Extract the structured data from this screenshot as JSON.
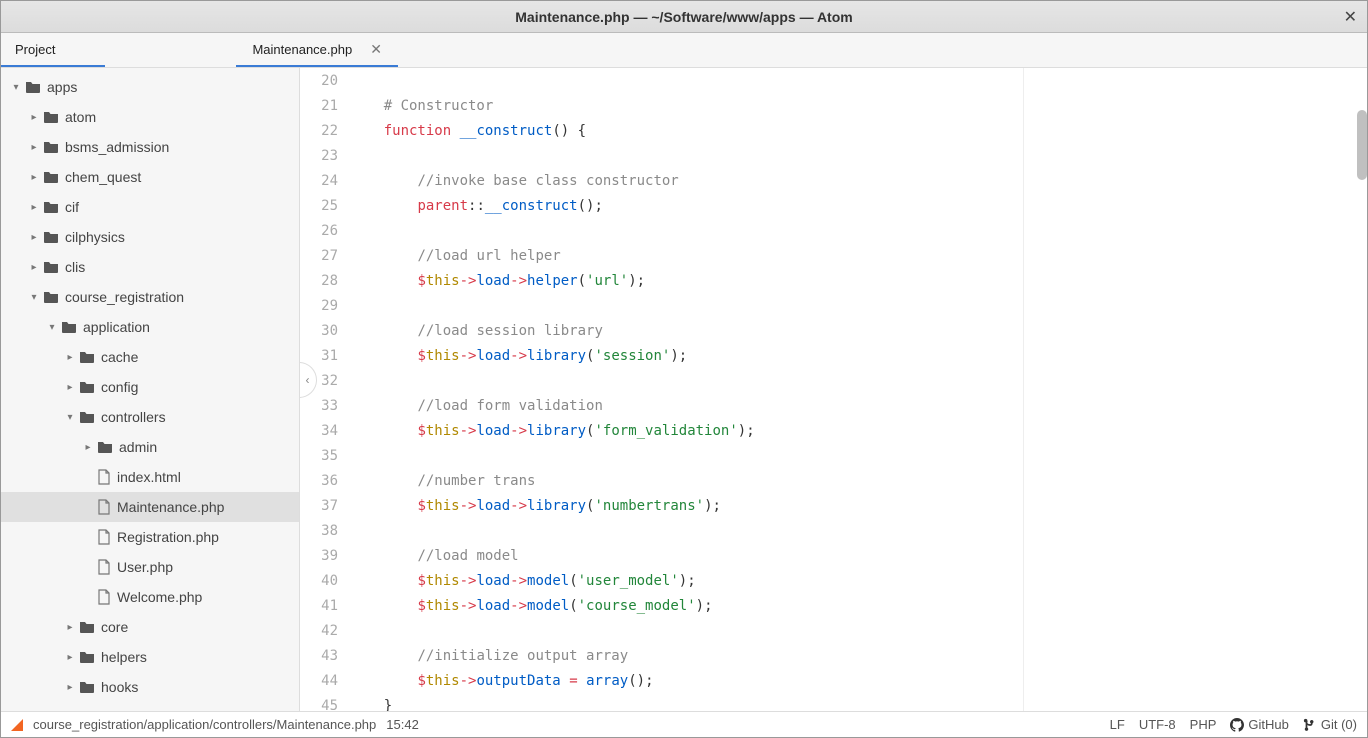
{
  "window": {
    "title": "Maintenance.php — ~/Software/www/apps — Atom"
  },
  "dock": {
    "project_label": "Project"
  },
  "tabs": [
    {
      "label": "Maintenance.php",
      "active": true
    }
  ],
  "tree": [
    {
      "depth": 0,
      "type": "folder",
      "open": true,
      "name": "apps"
    },
    {
      "depth": 1,
      "type": "folder",
      "open": false,
      "name": "atom"
    },
    {
      "depth": 1,
      "type": "folder",
      "open": false,
      "name": "bsms_admission"
    },
    {
      "depth": 1,
      "type": "folder",
      "open": false,
      "name": "chem_quest"
    },
    {
      "depth": 1,
      "type": "folder",
      "open": false,
      "name": "cif"
    },
    {
      "depth": 1,
      "type": "folder",
      "open": false,
      "name": "cilphysics"
    },
    {
      "depth": 1,
      "type": "folder",
      "open": false,
      "name": "clis"
    },
    {
      "depth": 1,
      "type": "folder",
      "open": true,
      "name": "course_registration"
    },
    {
      "depth": 2,
      "type": "folder",
      "open": true,
      "name": "application"
    },
    {
      "depth": 3,
      "type": "folder",
      "open": false,
      "name": "cache"
    },
    {
      "depth": 3,
      "type": "folder",
      "open": false,
      "name": "config"
    },
    {
      "depth": 3,
      "type": "folder",
      "open": true,
      "name": "controllers"
    },
    {
      "depth": 4,
      "type": "folder",
      "open": false,
      "name": "admin"
    },
    {
      "depth": 4,
      "type": "file",
      "name": "index.html"
    },
    {
      "depth": 4,
      "type": "file",
      "name": "Maintenance.php",
      "selected": true
    },
    {
      "depth": 4,
      "type": "file",
      "name": "Registration.php"
    },
    {
      "depth": 4,
      "type": "file",
      "name": "User.php"
    },
    {
      "depth": 4,
      "type": "file",
      "name": "Welcome.php"
    },
    {
      "depth": 3,
      "type": "folder",
      "open": false,
      "name": "core"
    },
    {
      "depth": 3,
      "type": "folder",
      "open": false,
      "name": "helpers"
    },
    {
      "depth": 3,
      "type": "folder",
      "open": false,
      "name": "hooks"
    }
  ],
  "editor": {
    "first_line": 20,
    "lines": [
      [],
      [
        {
          "t": "    ",
          "c": null
        },
        {
          "t": "# Constructor",
          "c": "cmt"
        }
      ],
      [
        {
          "t": "    ",
          "c": null
        },
        {
          "t": "function",
          "c": "kw"
        },
        {
          "t": " ",
          "c": null
        },
        {
          "t": "__construct",
          "c": "fn"
        },
        {
          "t": "() {",
          "c": null
        }
      ],
      [],
      [
        {
          "t": "        ",
          "c": null
        },
        {
          "t": "//invoke base class constructor",
          "c": "cmt"
        }
      ],
      [
        {
          "t": "        ",
          "c": null
        },
        {
          "t": "parent",
          "c": "kw"
        },
        {
          "t": "::",
          "c": null
        },
        {
          "t": "__construct",
          "c": "fn"
        },
        {
          "t": "();",
          "c": null
        }
      ],
      [],
      [
        {
          "t": "        ",
          "c": null
        },
        {
          "t": "//load url helper",
          "c": "cmt"
        }
      ],
      [
        {
          "t": "        ",
          "c": null
        },
        {
          "t": "$",
          "c": "op"
        },
        {
          "t": "this",
          "c": "var"
        },
        {
          "t": "->",
          "c": "op"
        },
        {
          "t": "load",
          "c": "prop"
        },
        {
          "t": "->",
          "c": "op"
        },
        {
          "t": "helper",
          "c": "fn"
        },
        {
          "t": "(",
          "c": null
        },
        {
          "t": "'url'",
          "c": "str"
        },
        {
          "t": ");",
          "c": null
        }
      ],
      [],
      [
        {
          "t": "        ",
          "c": null
        },
        {
          "t": "//load session library",
          "c": "cmt"
        }
      ],
      [
        {
          "t": "        ",
          "c": null
        },
        {
          "t": "$",
          "c": "op"
        },
        {
          "t": "this",
          "c": "var"
        },
        {
          "t": "->",
          "c": "op"
        },
        {
          "t": "load",
          "c": "prop"
        },
        {
          "t": "->",
          "c": "op"
        },
        {
          "t": "library",
          "c": "fn"
        },
        {
          "t": "(",
          "c": null
        },
        {
          "t": "'session'",
          "c": "str"
        },
        {
          "t": ");",
          "c": null
        }
      ],
      [],
      [
        {
          "t": "        ",
          "c": null
        },
        {
          "t": "//load form validation",
          "c": "cmt"
        }
      ],
      [
        {
          "t": "        ",
          "c": null
        },
        {
          "t": "$",
          "c": "op"
        },
        {
          "t": "this",
          "c": "var"
        },
        {
          "t": "->",
          "c": "op"
        },
        {
          "t": "load",
          "c": "prop"
        },
        {
          "t": "->",
          "c": "op"
        },
        {
          "t": "library",
          "c": "fn"
        },
        {
          "t": "(",
          "c": null
        },
        {
          "t": "'form_validation'",
          "c": "str"
        },
        {
          "t": ");",
          "c": null
        }
      ],
      [],
      [
        {
          "t": "        ",
          "c": null
        },
        {
          "t": "//number trans",
          "c": "cmt"
        }
      ],
      [
        {
          "t": "        ",
          "c": null
        },
        {
          "t": "$",
          "c": "op"
        },
        {
          "t": "this",
          "c": "var"
        },
        {
          "t": "->",
          "c": "op"
        },
        {
          "t": "load",
          "c": "prop"
        },
        {
          "t": "->",
          "c": "op"
        },
        {
          "t": "library",
          "c": "fn"
        },
        {
          "t": "(",
          "c": null
        },
        {
          "t": "'numbertrans'",
          "c": "str"
        },
        {
          "t": ");",
          "c": null
        }
      ],
      [],
      [
        {
          "t": "        ",
          "c": null
        },
        {
          "t": "//load model",
          "c": "cmt"
        }
      ],
      [
        {
          "t": "        ",
          "c": null
        },
        {
          "t": "$",
          "c": "op"
        },
        {
          "t": "this",
          "c": "var"
        },
        {
          "t": "->",
          "c": "op"
        },
        {
          "t": "load",
          "c": "prop"
        },
        {
          "t": "->",
          "c": "op"
        },
        {
          "t": "model",
          "c": "fn"
        },
        {
          "t": "(",
          "c": null
        },
        {
          "t": "'user_model'",
          "c": "str"
        },
        {
          "t": ");",
          "c": null
        }
      ],
      [
        {
          "t": "        ",
          "c": null
        },
        {
          "t": "$",
          "c": "op"
        },
        {
          "t": "this",
          "c": "var"
        },
        {
          "t": "->",
          "c": "op"
        },
        {
          "t": "load",
          "c": "prop"
        },
        {
          "t": "->",
          "c": "op"
        },
        {
          "t": "model",
          "c": "fn"
        },
        {
          "t": "(",
          "c": null
        },
        {
          "t": "'course_model'",
          "c": "str"
        },
        {
          "t": ");",
          "c": null
        }
      ],
      [],
      [
        {
          "t": "        ",
          "c": null
        },
        {
          "t": "//initialize output array",
          "c": "cmt"
        }
      ],
      [
        {
          "t": "        ",
          "c": null
        },
        {
          "t": "$",
          "c": "op"
        },
        {
          "t": "this",
          "c": "var"
        },
        {
          "t": "->",
          "c": "op"
        },
        {
          "t": "outputData",
          "c": "prop"
        },
        {
          "t": " ",
          "c": null
        },
        {
          "t": "=",
          "c": "op"
        },
        {
          "t": " ",
          "c": null
        },
        {
          "t": "array",
          "c": "fn"
        },
        {
          "t": "();",
          "c": null
        }
      ],
      [
        {
          "t": "    }",
          "c": null
        }
      ]
    ]
  },
  "statusbar": {
    "filepath": "course_registration/application/controllers/Maintenance.php",
    "cursor": "15:42",
    "line_ending": "LF",
    "encoding": "UTF-8",
    "grammar": "PHP",
    "github": "GitHub",
    "git": "Git (0)"
  }
}
